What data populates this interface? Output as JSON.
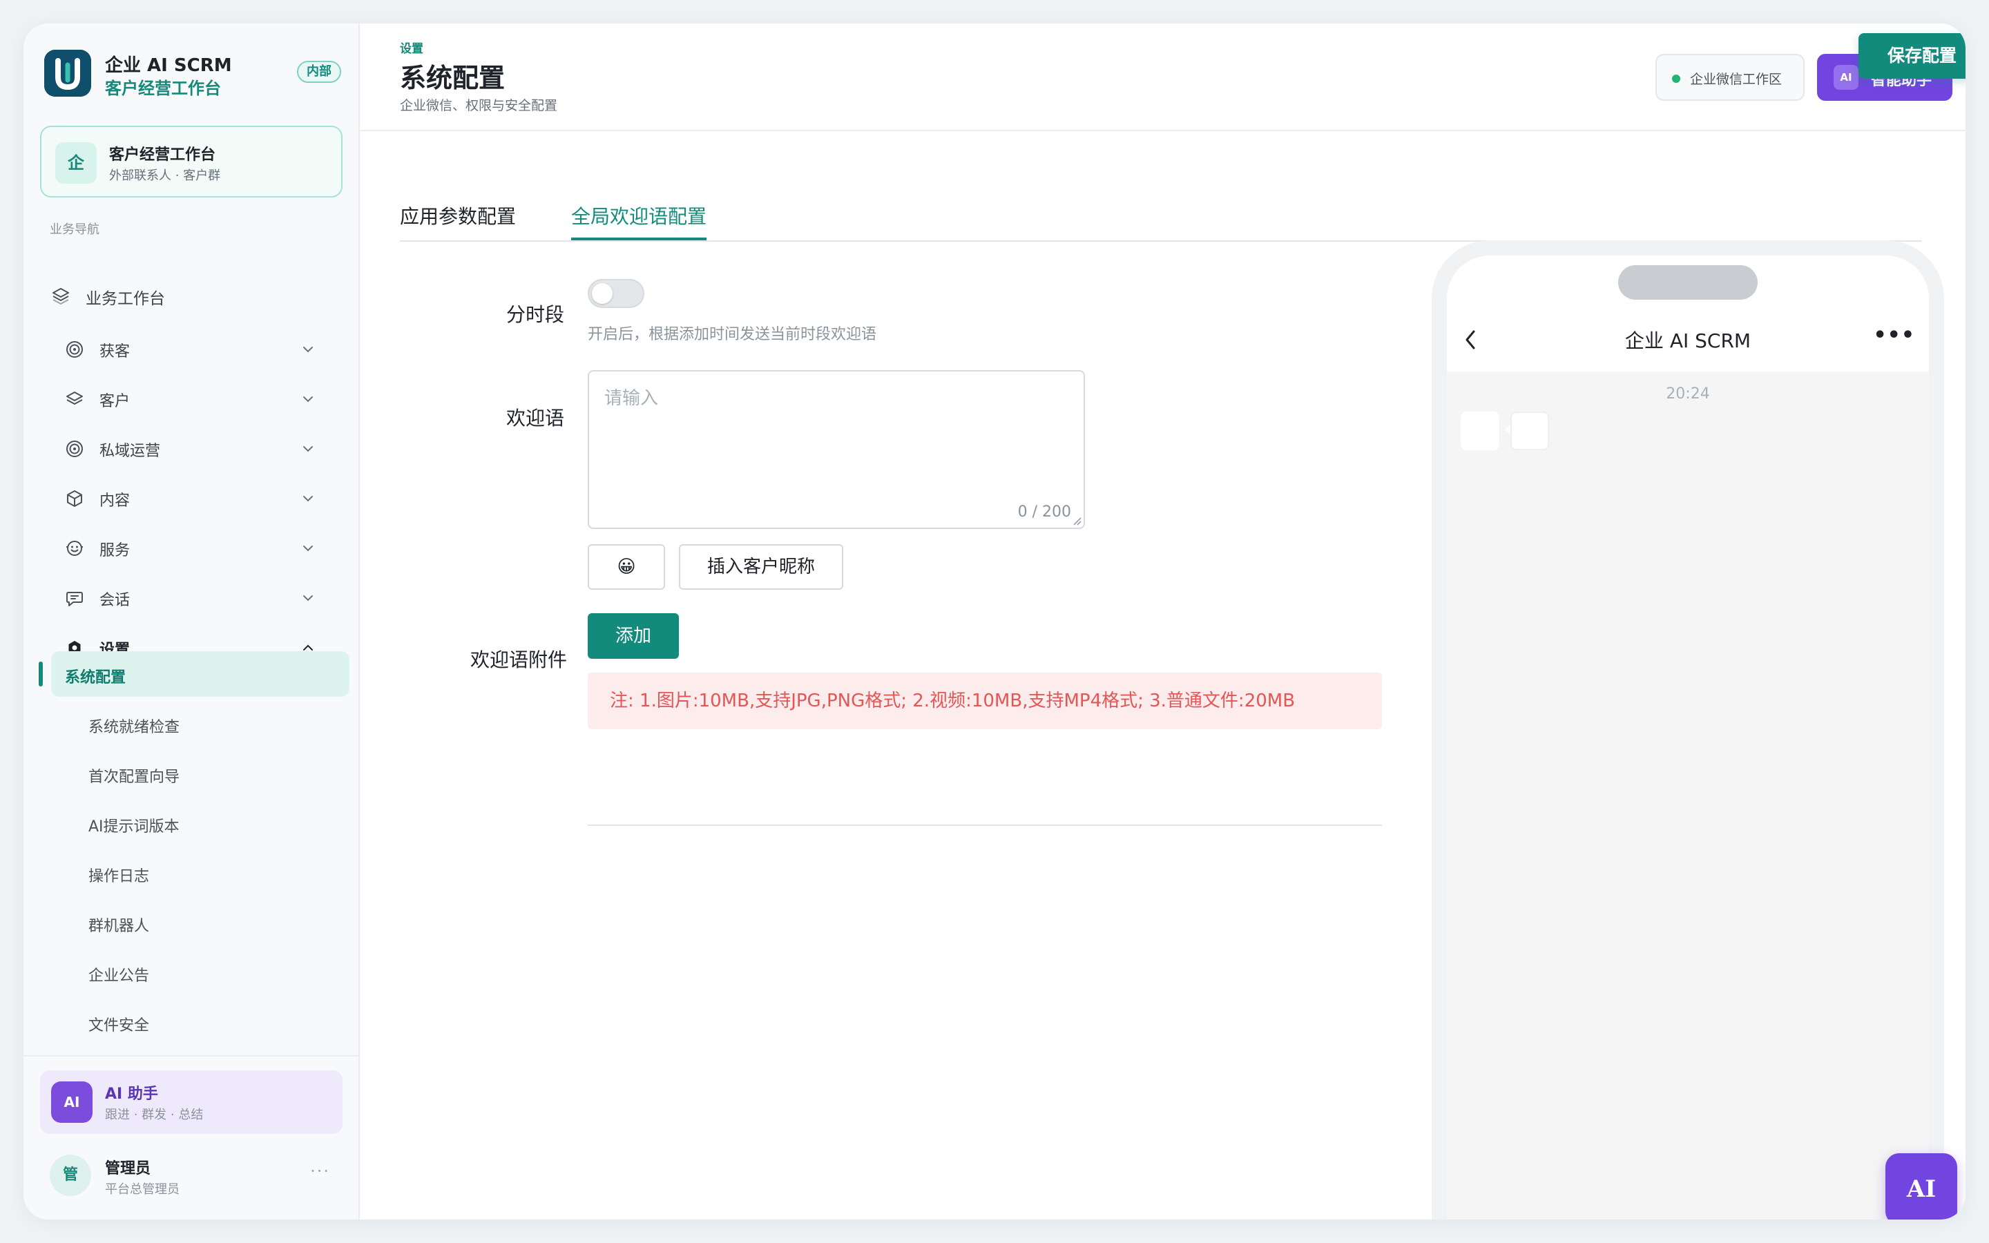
{
  "brand": {
    "title": "企业 AI SCRM",
    "subtitle": "客户经营工作台",
    "badge": "内部"
  },
  "workspace_card": {
    "icon": "企",
    "title": "客户经营工作台",
    "subtitle": "外部联系人 · 客户群"
  },
  "sidebar": {
    "caption": "业务导航",
    "top_item": {
      "label": "业务工作台",
      "icon": "layers-icon"
    },
    "groups": [
      {
        "label": "获客",
        "icon": "target-icon",
        "expanded": false
      },
      {
        "label": "客户",
        "icon": "layers-icon",
        "expanded": false
      },
      {
        "label": "私域运营",
        "icon": "target-icon",
        "expanded": false
      },
      {
        "label": "内容",
        "icon": "cube-icon",
        "expanded": false
      },
      {
        "label": "服务",
        "icon": "smile-icon",
        "expanded": false
      },
      {
        "label": "会话",
        "icon": "chat-icon",
        "expanded": false
      },
      {
        "label": "设置",
        "icon": "settings-icon",
        "expanded": true
      }
    ],
    "settings_items": [
      {
        "label": "系统配置",
        "active": true
      },
      {
        "label": "系统就绪检查"
      },
      {
        "label": "首次配置向导"
      },
      {
        "label": "AI提示词版本"
      },
      {
        "label": "操作日志"
      },
      {
        "label": "群机器人"
      },
      {
        "label": "企业公告"
      },
      {
        "label": "文件安全"
      }
    ],
    "ai_card": {
      "icon": "AI",
      "title": "AI 助手",
      "subtitle": "跟进 · 群发 · 总结"
    },
    "user": {
      "avatar": "管",
      "name": "管理员",
      "role": "平台总管理员",
      "more": "···"
    }
  },
  "header": {
    "breadcrumb": "设置",
    "title": "系统配置",
    "subtitle": "企业微信、权限与安全配置",
    "workspace_pill": "企业微信工作区",
    "assistant_icon": "AI",
    "assistant_label": "智能助手",
    "save_label": "保存配置"
  },
  "tabs": [
    {
      "label": "应用参数配置",
      "active": false
    },
    {
      "label": "全局欢迎语配置",
      "active": true
    }
  ],
  "form": {
    "time_split_label": "分时段",
    "time_split_on": false,
    "time_split_hint": "开启后，根据添加时间发送当前时段欢迎语",
    "welcome_label": "欢迎语",
    "welcome_placeholder": "请输入",
    "welcome_value": "",
    "welcome_count": "0 / 200",
    "emoji_button": "😀",
    "insert_nickname_button": "插入客户昵称",
    "attachment_label": "欢迎语附件",
    "add_button": "添加",
    "note": "注: 1.图片:10MB,支持JPG,PNG格式; 2.视频:10MB,支持MP4格式; 3.普通文件:20MB"
  },
  "phone_preview": {
    "title": "企业 AI SCRM",
    "time": "20:24",
    "more": "•••"
  },
  "fab": {
    "label": "AI"
  },
  "colors": {
    "primary": "#128a7c",
    "accent_purple": "#7244e0",
    "danger": "#e35656"
  }
}
